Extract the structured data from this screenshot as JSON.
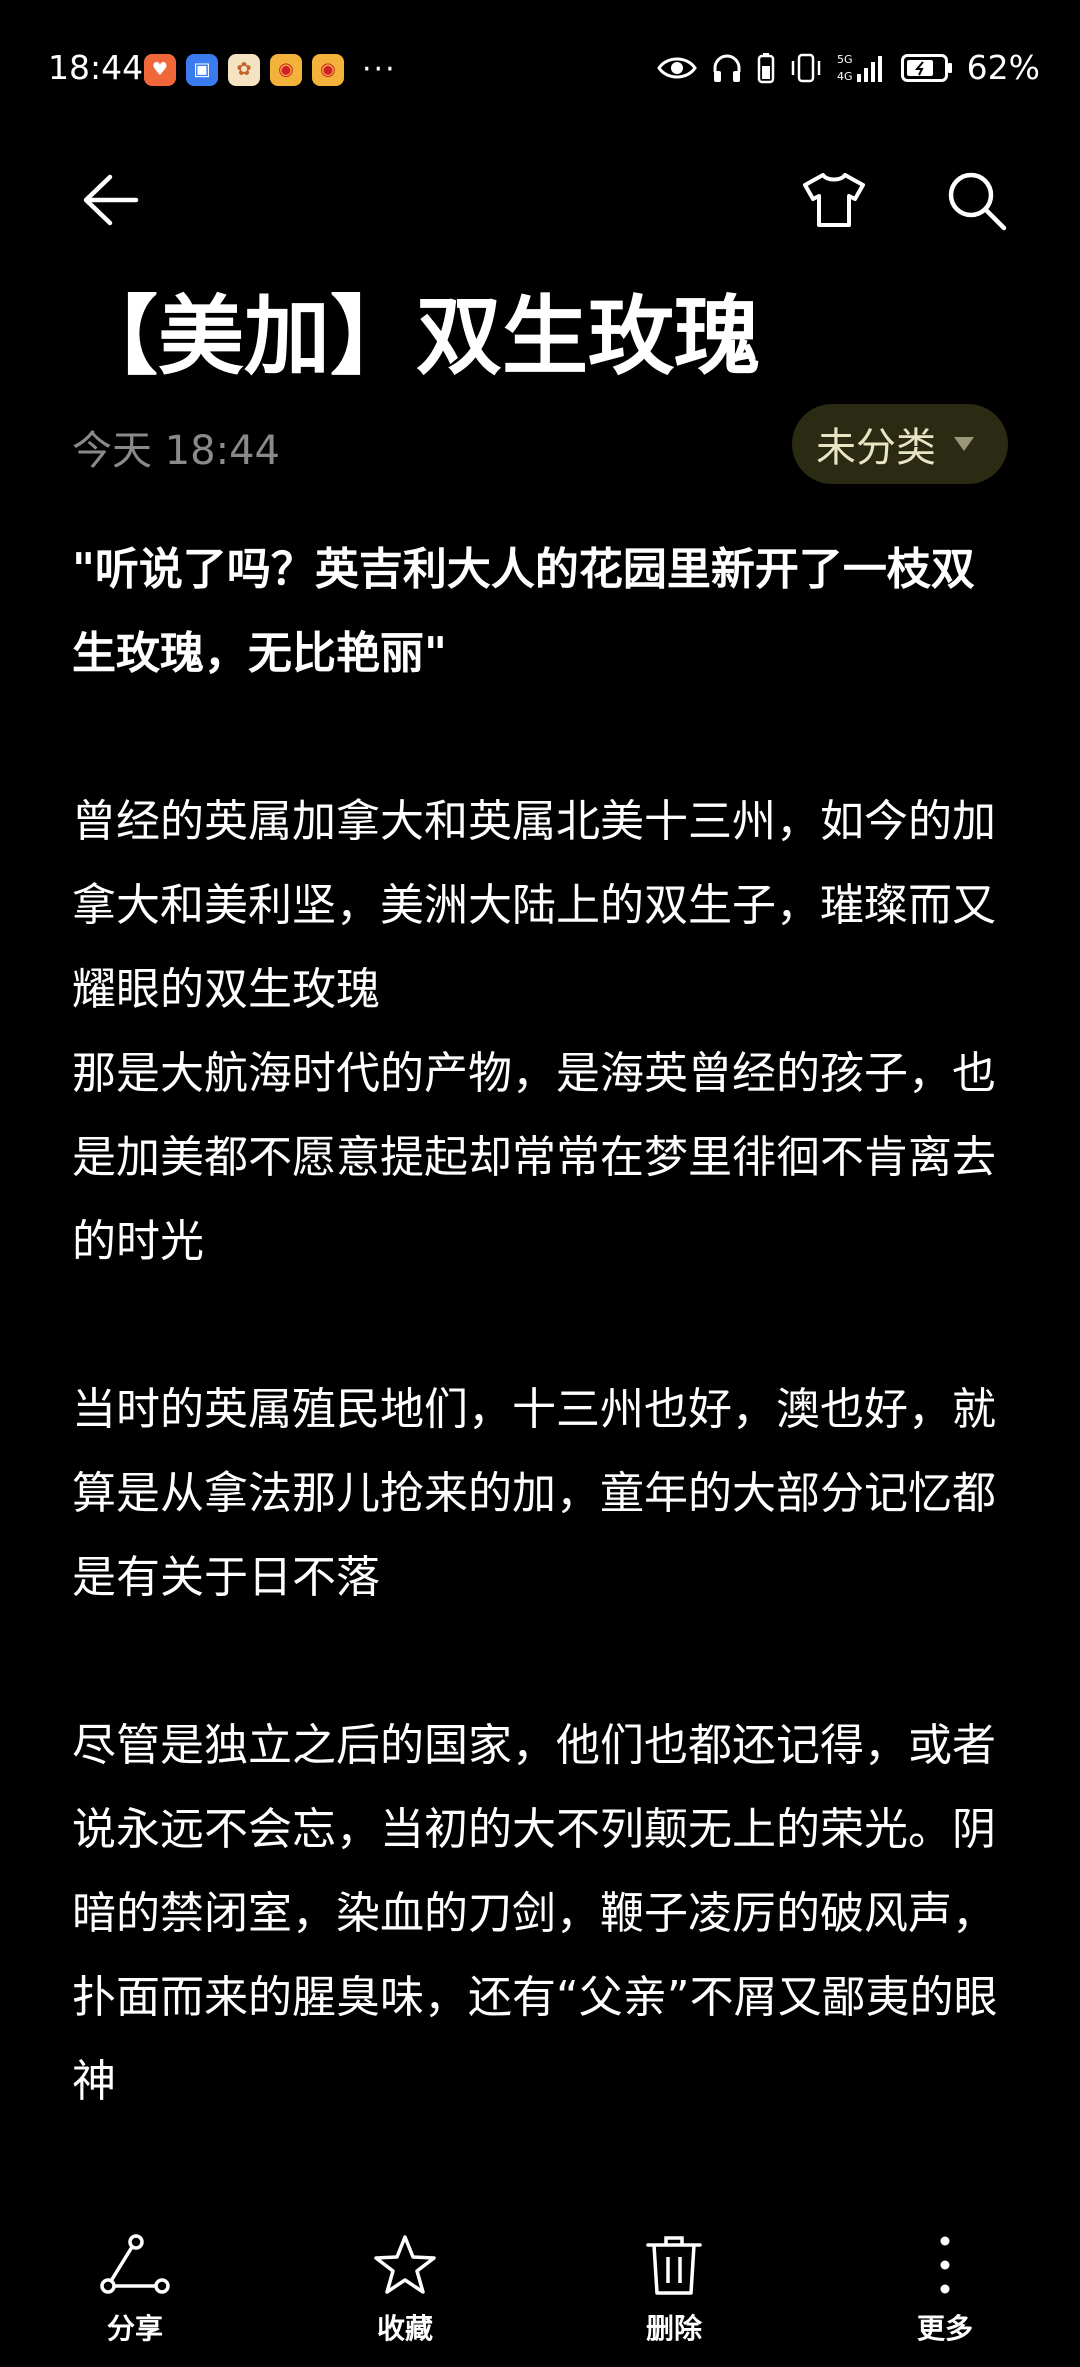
{
  "status_bar": {
    "time": "18:44",
    "more": "···",
    "battery": "62%",
    "notif_icons": [
      "shopping-icon",
      "contacts-icon",
      "app-icon",
      "weibo-icon",
      "weibo-icon"
    ]
  },
  "note": {
    "title": "【美加】双生玫瑰",
    "date": "今天 18:44",
    "category": "未分类",
    "paragraphs": [
      "\"听说了吗？英吉利大人的花园里新开了一枝双生玫瑰，无比艳丽\"",
      "曾经的英属加拿大和英属北美十三州，如今的加拿大和美利坚，美洲大陆上的双生子，璀璨而又耀眼的双生玫瑰",
      "那是大航海时代的产物，是海英曾经的孩子，也是加美都不愿意提起却常常在梦里徘徊不肯离去的时光",
      "当时的英属殖民地们，十三州也好，澳也好，就算是从拿法那儿抢来的加，童年的大部分记忆都是有关于日不落",
      "尽管是独立之后的国家，他们也都还记得，或者说永远不会忘，当初的大不列颠无上的荣光。阴暗的禁闭室，染血的刀剑，鞭子凌厉的破风声，扑面而来的腥臭味，还有“父亲”不屑又鄙夷的眼神"
    ]
  },
  "bottom_bar": {
    "share": "分享",
    "favorite": "收藏",
    "delete": "删除",
    "more": "更多"
  },
  "colors": {
    "background": "#000000",
    "text": "#ffffff",
    "muted": "#8a8a8a",
    "pill_bg": "#2b2a12"
  }
}
